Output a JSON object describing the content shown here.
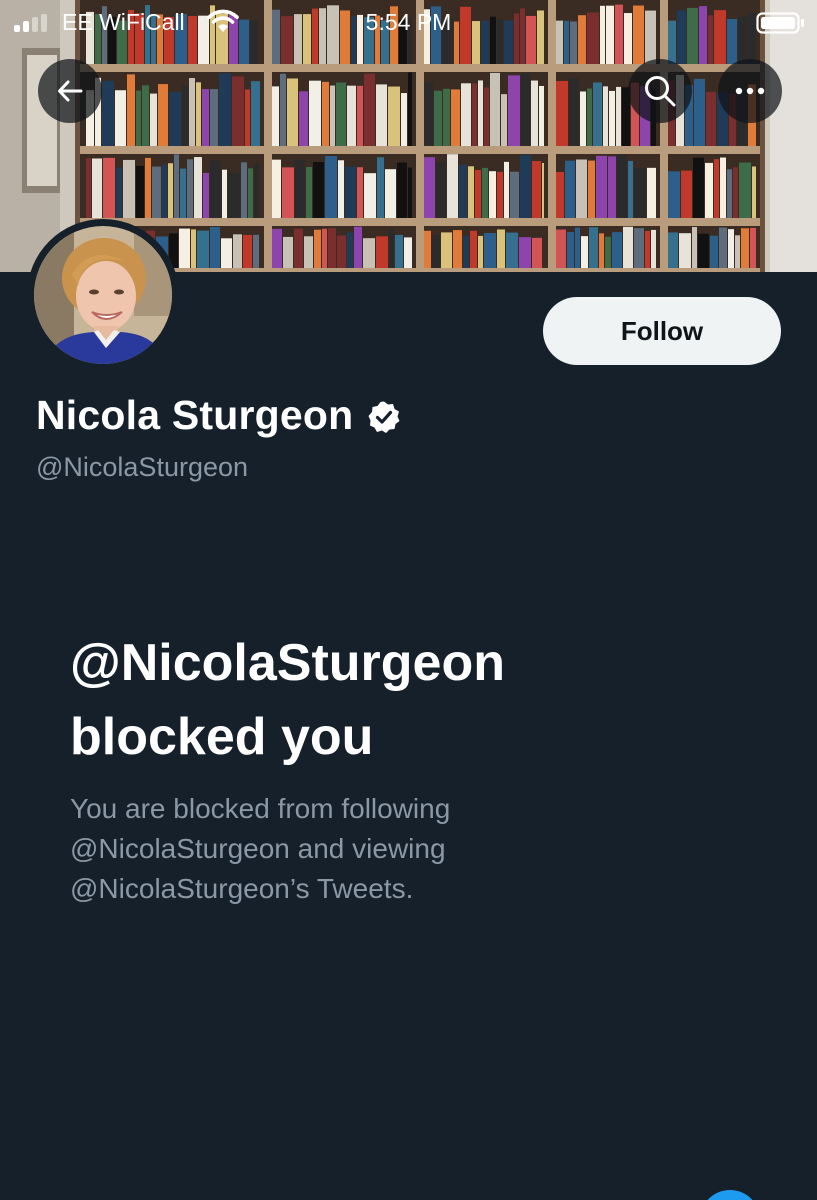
{
  "status_bar": {
    "carrier": "EE WiFiCall",
    "time": "5:54 PM",
    "signal_bars_active": 2,
    "signal_bars_total": 4,
    "wifi_icon": "wifi-icon",
    "battery_icon": "battery-icon"
  },
  "header": {
    "back_icon": "arrow-left-icon",
    "search_icon": "search-icon",
    "more_icon": "more-horizontal-icon"
  },
  "profile": {
    "display_name": "Nicola Sturgeon",
    "verified": true,
    "handle": "@NicolaSturgeon",
    "follow_label": "Follow"
  },
  "blocked_notice": {
    "title_line1": "@NicolaSturgeon",
    "title_line2": "blocked you",
    "description_line1": "You are blocked from following",
    "description_line2": "@NicolaSturgeon and viewing",
    "description_line3": "@NicolaSturgeon’s Tweets."
  },
  "colors": {
    "background": "#15202b",
    "primary_text": "#ffffff",
    "secondary_text": "#8b98a5",
    "follow_button_bg": "#eff3f4",
    "accent": "#1d9bf0"
  }
}
